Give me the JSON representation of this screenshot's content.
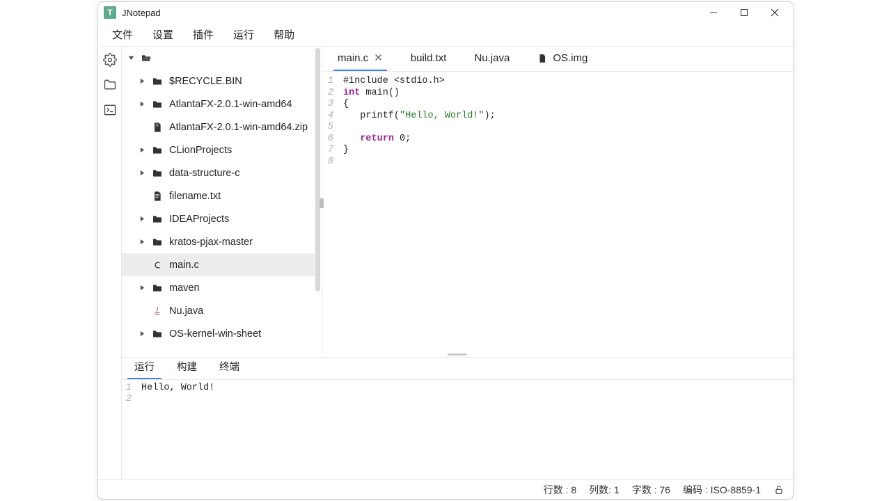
{
  "app": {
    "title": "JNotepad",
    "icon_letter": "T"
  },
  "menu": {
    "file": "文件",
    "settings": "设置",
    "plugins": "插件",
    "run": "运行",
    "help": "帮助"
  },
  "sidebar": {
    "icons": [
      "gear-icon",
      "folder-icon",
      "terminal-icon"
    ]
  },
  "tree": {
    "root_open": true,
    "items": [
      {
        "type": "folder",
        "name": "$RECYCLE.BIN",
        "expandable": true
      },
      {
        "type": "folder",
        "name": "AtlantaFX-2.0.1-win-amd64",
        "expandable": true
      },
      {
        "type": "zip",
        "name": "AtlantaFX-2.0.1-win-amd64.zip",
        "expandable": false
      },
      {
        "type": "folder",
        "name": "CLionProjects",
        "expandable": true
      },
      {
        "type": "folder",
        "name": "data-structure-c",
        "expandable": true
      },
      {
        "type": "txt",
        "name": "filename.txt",
        "expandable": false
      },
      {
        "type": "folder",
        "name": "IDEAProjects",
        "expandable": true
      },
      {
        "type": "folder",
        "name": "kratos-pjax-master",
        "expandable": true
      },
      {
        "type": "c",
        "name": "main.c",
        "expandable": false,
        "selected": true
      },
      {
        "type": "folder",
        "name": "maven",
        "expandable": true
      },
      {
        "type": "java",
        "name": "Nu.java",
        "expandable": false
      },
      {
        "type": "folder",
        "name": "OS-kernel-win-sheet",
        "expandable": true
      }
    ]
  },
  "tabs": [
    {
      "label": "main.c",
      "active": true,
      "closable": true,
      "icon": null
    },
    {
      "label": "build.txt",
      "active": false,
      "closable": false,
      "icon": null
    },
    {
      "label": "Nu.java",
      "active": false,
      "closable": false,
      "icon": null
    },
    {
      "label": "OS.img",
      "active": false,
      "closable": false,
      "icon": "file"
    }
  ],
  "code": {
    "lines": 8,
    "content": [
      {
        "n": 1,
        "tokens": [
          {
            "t": "#include <stdio.h>",
            "c": "plain"
          }
        ]
      },
      {
        "n": 2,
        "tokens": [
          {
            "t": "int",
            "c": "keyword"
          },
          {
            "t": " main()",
            "c": "plain"
          }
        ]
      },
      {
        "n": 3,
        "tokens": [
          {
            "t": "{",
            "c": "plain"
          }
        ]
      },
      {
        "n": 4,
        "tokens": [
          {
            "t": "   printf(",
            "c": "plain"
          },
          {
            "t": "\"Hello, World!\"",
            "c": "string"
          },
          {
            "t": ");",
            "c": "plain"
          }
        ]
      },
      {
        "n": 5,
        "tokens": []
      },
      {
        "n": 6,
        "tokens": [
          {
            "t": "   ",
            "c": "plain"
          },
          {
            "t": "return",
            "c": "keyword"
          },
          {
            "t": " 0;",
            "c": "plain"
          }
        ]
      },
      {
        "n": 7,
        "tokens": [
          {
            "t": "}",
            "c": "plain"
          }
        ]
      },
      {
        "n": 8,
        "tokens": []
      }
    ]
  },
  "console": {
    "tabs": {
      "run": "运行",
      "build": "构建",
      "terminal": "终端"
    },
    "active": "run",
    "output": [
      {
        "n": 1,
        "text": "Hello, World!"
      },
      {
        "n": 2,
        "text": ""
      }
    ]
  },
  "status": {
    "rows_label": "行数 :",
    "rows_value": "8",
    "cols_label": "列数:",
    "cols_value": "1",
    "chars_label": "字数 :",
    "chars_value": "76",
    "encoding_label": "编码 :",
    "encoding_value": "ISO-8859-1"
  }
}
